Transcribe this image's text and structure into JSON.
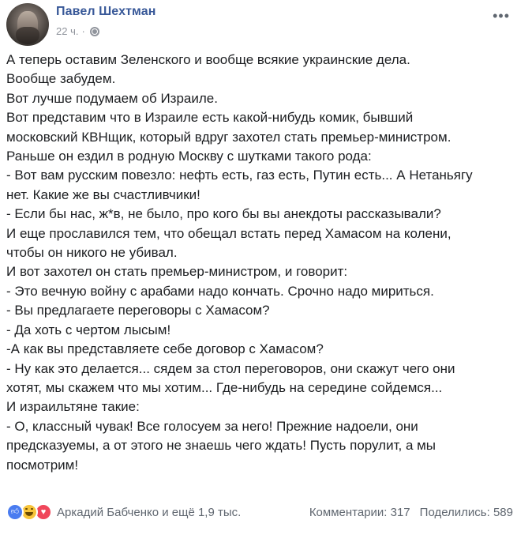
{
  "post": {
    "author": "Павел Шехтман",
    "time": "22 ч.",
    "separator": "·",
    "lines": [
      "А теперь оставим Зеленского и вообще всякие украинские дела.",
      "Вообще забудем.",
      "Вот лучше подумаем об Израиле.",
      "Вот представим что в Израиле есть какой-нибудь комик, бывший",
      "московский КВНщик, который вдруг захотел стать премьер-министром.",
      "Раньше он ездил в родную Москву с шутками такого рода:",
      "- Вот вам русским повезло: нефть есть, газ есть, Путин есть... А Нетаньягу",
      "нет. Какие же вы счастливчики!",
      "- Если бы нас, ж*в, не было, про кого бы вы анекдоты рассказывали?",
      "И еще прославился тем, что обещал встать перед Хамасом на колени,",
      "чтобы он никого не убивал.",
      "И вот захотел он стать премьер-министром, и говорит:",
      "- Это вечную войну с арабами надо кончать. Срочно надо мириться.",
      "- Вы предлагаете переговоры с Хамасом?",
      "- Да хоть с чертом лысым!",
      "-А как вы представляете себе договор с Хамасом?",
      "- Ну как это делается... сядем за стол переговоров, они скажут чего они",
      "хотят, мы скажем что мы хотим... Где-нибудь на середине сойдемся...",
      "И израильтяне такие:",
      "- О, классный чувак! Все голосуем за него! Прежние надоели, они",
      "предсказуемы, а от этого не знаешь чего ждать! Пусть порулит, а мы",
      "посмотрим!"
    ]
  },
  "footer": {
    "reactions": [
      "like-icon",
      "haha-icon",
      "love-icon"
    ],
    "reactors": "Аркадий Бабченко и ещё 1,9 тыс.",
    "comments": "Комментарии: 317",
    "shares": "Поделились: 589"
  },
  "colors": {
    "author": "#385898",
    "meta": "#90949c",
    "like": "#4a7cf0",
    "haha": "#f7c43a",
    "love": "#f0475b"
  }
}
